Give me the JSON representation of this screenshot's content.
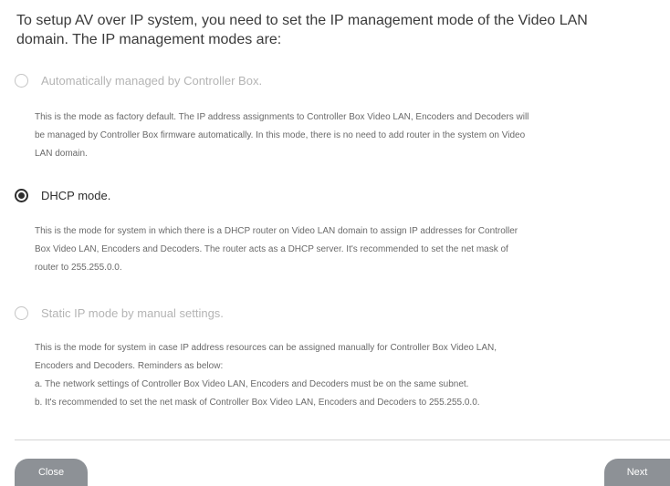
{
  "intro": {
    "line1": "To setup AV over IP system, you need to set the IP management mode of the Video LAN",
    "line2": "domain. The IP management modes are:"
  },
  "options": [
    {
      "label": "Automatically managed by Controller Box.",
      "selected": false,
      "description": [
        "This is the mode as factory default. The IP address assignments to Controller Box Video LAN, Encoders and Decoders will",
        "be managed by Controller Box firmware automatically. In this mode, there is no need to add router in the system on Video",
        "LAN domain."
      ]
    },
    {
      "label": "DHCP mode.",
      "selected": true,
      "description": [
        "This is the mode for system in which there is a DHCP router on Video LAN domain to assign IP addresses for Controller",
        "Box Video LAN, Encoders and Decoders. The router acts as a DHCP server. It's recommended to set the net mask of",
        "router to 255.255.0.0."
      ]
    },
    {
      "label": "Static IP mode by manual settings.",
      "selected": false,
      "description": [
        "This is the mode for system in case IP address resources can be assigned manually for Controller Box Video LAN,",
        "Encoders and Decoders. Reminders as below:",
        "a. The network settings of Controller Box Video LAN, Encoders and Decoders must be on the same subnet.",
        "b. It's recommended to set the net mask of Controller Box Video LAN, Encoders and Decoders to 255.255.0.0."
      ]
    }
  ],
  "footer": {
    "close_label": "Close",
    "next_label": "Next"
  },
  "colors": {
    "selected_radio": "#2e2e2e",
    "unselected_text": "#b4b4b4",
    "button_bg": "#8d9196"
  }
}
